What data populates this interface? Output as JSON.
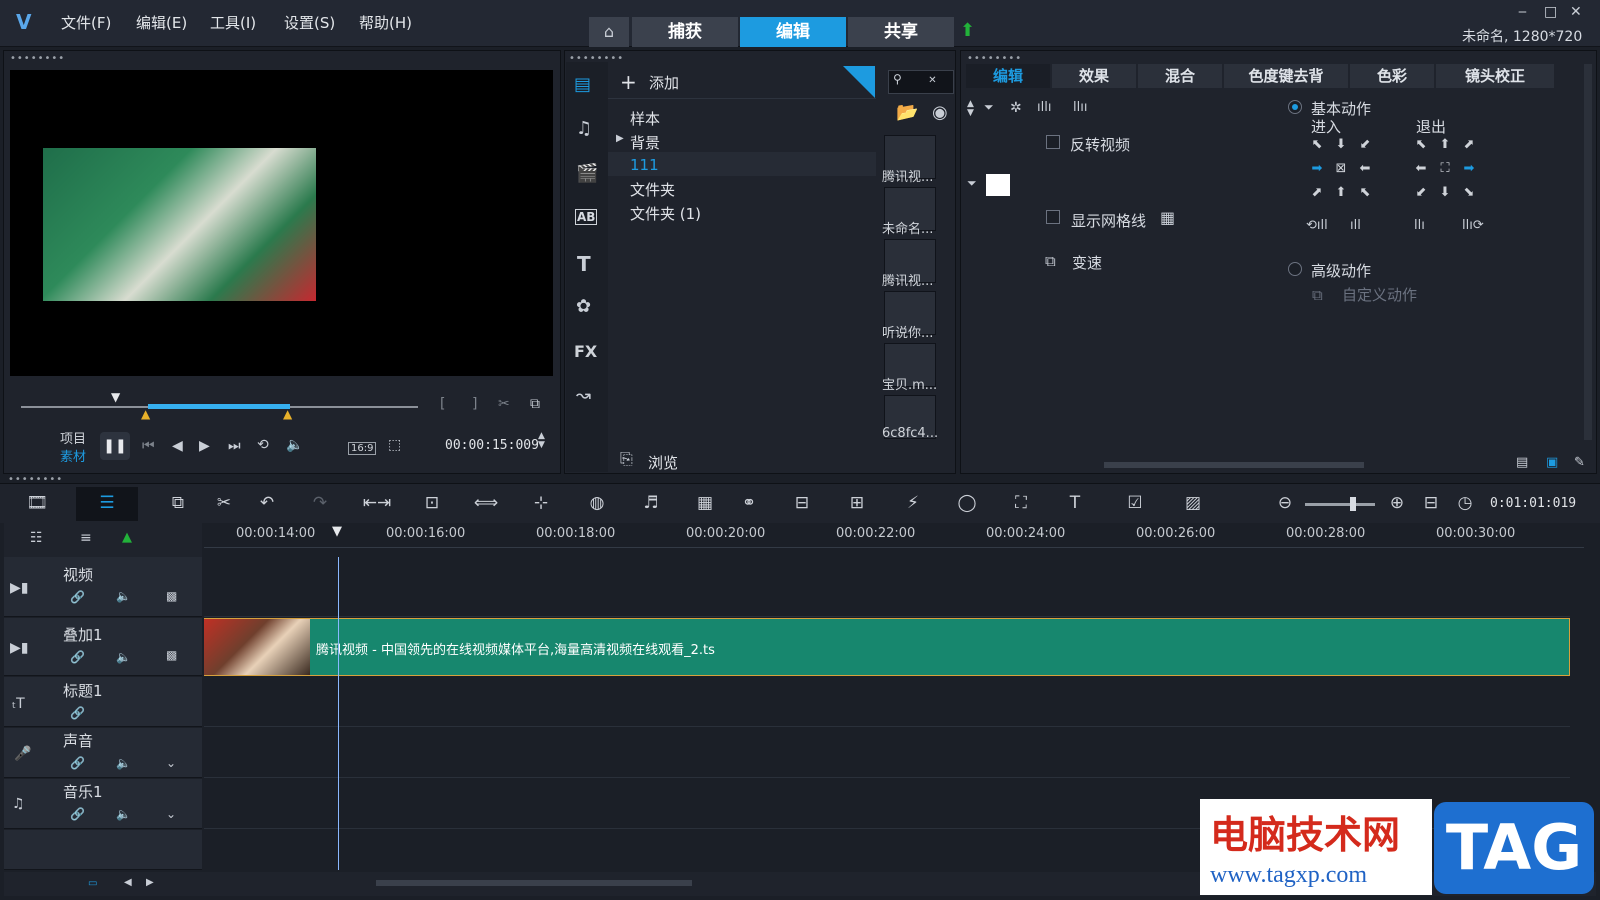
{
  "window": {
    "title_info": "未命名, 1280*720"
  },
  "menu": [
    "文件(F)",
    "编辑(E)",
    "工具(I)",
    "设置(S)",
    "帮助(H)"
  ],
  "modes": {
    "capture": "捕获",
    "edit": "编辑",
    "share": "共享"
  },
  "player": {
    "project_label": "项目",
    "clip_label": "素材",
    "timecode": "00:00:15:009",
    "aspect": "16:9"
  },
  "library": {
    "add_label": "添加",
    "browse_label": "浏览",
    "folders": [
      "样本",
      "背景",
      "111",
      "文件夹",
      "文件夹 (1)"
    ],
    "selected_folder": "111",
    "thumbs": [
      "腾讯视...",
      "未命名...",
      "腾讯视...",
      "听说你...",
      "宝贝.m...",
      "6c8fc4..."
    ],
    "category_fx": "FX"
  },
  "options": {
    "tabs": [
      "编辑",
      "效果",
      "混合",
      "色度键去背",
      "色彩",
      "镜头校正"
    ],
    "active_tab": "编辑",
    "reverse_video": "反转视频",
    "show_grid": "显示网格线",
    "speed": "变速",
    "basic_motion": "基本动作",
    "enter": "进入",
    "exit": "退出",
    "advanced_motion": "高级动作",
    "custom_motion": "自定义动作"
  },
  "timeline": {
    "ruler": [
      "00:00:14:00",
      "00:00:16:00",
      "00:00:18:00",
      "00:00:20:00",
      "00:00:22:00",
      "00:00:24:00",
      "00:00:26:00",
      "00:00:28:00",
      "00:00:30:00"
    ],
    "timecode": "0:01:01:019",
    "tracks": [
      "视频",
      "叠加1",
      "标题1",
      "声音",
      "音乐1"
    ],
    "clip_title": "腾讯视频 - 中国领先的在线视频媒体平台,海量高清视频在线观看_2.ts"
  },
  "watermark": {
    "site_name": "电脑技术网",
    "url": "www.tagxp.com",
    "badge": "TAG"
  },
  "colors": {
    "accent": "#1d9be0",
    "clip": "#17876e",
    "clip_border": "#d7a13d"
  }
}
